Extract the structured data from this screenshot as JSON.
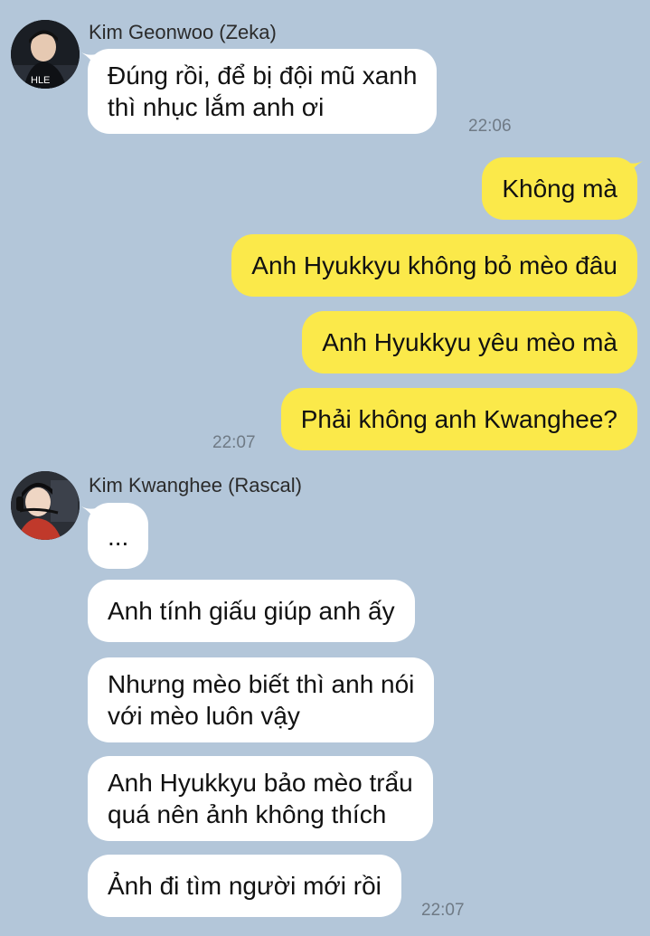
{
  "senders": {
    "zeka": {
      "name": "Kim Geonwoo (Zeka)",
      "avatar_icon": "avatar-zeka"
    },
    "rascal": {
      "name": "Kim Kwanghee (Rascal)",
      "avatar_icon": "avatar-rascal"
    }
  },
  "colors": {
    "background": "#b3c6d9",
    "incoming_bubble": "#ffffff",
    "outgoing_bubble": "#fbe94a",
    "timestamp": "#6f7a85"
  },
  "messages": [
    {
      "sender": "zeka",
      "direction": "incoming",
      "lines": [
        "Đúng rồi, để bị đội mũ xanh",
        "thì nhục lắm anh ơi"
      ],
      "time": "22:06"
    },
    {
      "sender": "me",
      "direction": "outgoing",
      "lines": [
        "Không mà"
      ]
    },
    {
      "sender": "me",
      "direction": "outgoing",
      "lines": [
        "Anh Hyukkyu không bỏ mèo đâu"
      ]
    },
    {
      "sender": "me",
      "direction": "outgoing",
      "lines": [
        "Anh Hyukkyu yêu mèo mà"
      ]
    },
    {
      "sender": "me",
      "direction": "outgoing",
      "lines": [
        "Phải không anh Kwanghee?"
      ],
      "time": "22:07"
    },
    {
      "sender": "rascal",
      "direction": "incoming",
      "lines": [
        "..."
      ]
    },
    {
      "sender": "rascal",
      "direction": "incoming",
      "lines": [
        "Anh tính giấu giúp anh ấy"
      ]
    },
    {
      "sender": "rascal",
      "direction": "incoming",
      "lines": [
        "Nhưng mèo biết thì anh nói",
        "với mèo luôn vậy"
      ]
    },
    {
      "sender": "rascal",
      "direction": "incoming",
      "lines": [
        "Anh Hyukkyu bảo mèo trẩu",
        "quá nên ảnh không thích"
      ]
    },
    {
      "sender": "rascal",
      "direction": "incoming",
      "lines": [
        "Ảnh đi tìm người mới rồi"
      ],
      "time": "22:07"
    }
  ]
}
